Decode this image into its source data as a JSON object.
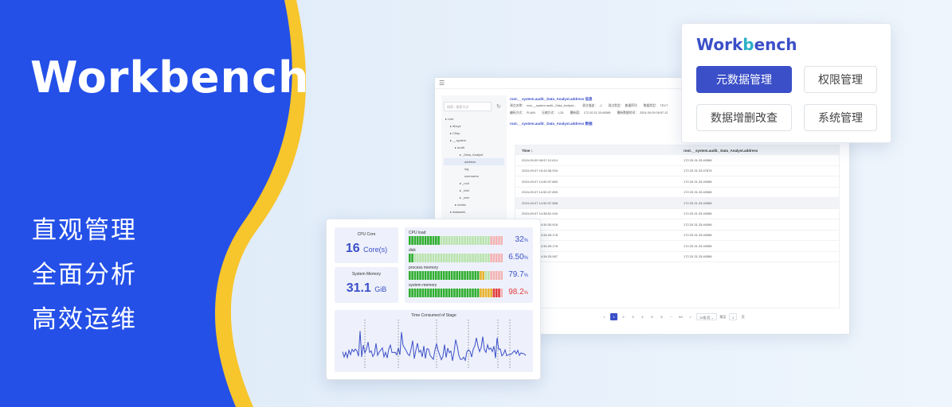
{
  "hero": {
    "title": "Workbench",
    "slogans": [
      "直观管理",
      "全面分析",
      "高效运维"
    ],
    "colors": {
      "blue": "#2450e8",
      "yellow": "#f7c52c"
    }
  },
  "popup": {
    "logo_main": "Work",
    "logo_accent": "b",
    "logo_rest": "ench",
    "buttons": [
      {
        "label": "元数据管理",
        "active": true
      },
      {
        "label": "权限管理",
        "active": false
      },
      {
        "label": "数据增删改查",
        "active": false
      },
      {
        "label": "系统管理",
        "active": false
      }
    ]
  },
  "app": {
    "menu_icon": "menu-icon",
    "search_placeholder": "搜索 / 搜索节点",
    "tree": [
      {
        "label": "root",
        "indent": 0
      },
      {
        "label": "abcyz",
        "indent": 1
      },
      {
        "label": "Clkrp",
        "indent": 1
      },
      {
        "label": "__system",
        "indent": 1
      },
      {
        "label": "audit",
        "indent": 2
      },
      {
        "label": "_Data_Analyst",
        "indent": 3
      },
      {
        "label": "address",
        "indent": 4,
        "selected": true
      },
      {
        "label": "log",
        "indent": 4
      },
      {
        "label": "username",
        "indent": 4
      },
      {
        "label": "_null",
        "indent": 3
      },
      {
        "label": "_test",
        "indent": 3
      },
      {
        "label": "_test",
        "indent": 3
      },
      {
        "label": "metric",
        "indent": 2
      },
      {
        "label": "dataseek",
        "indent": 1
      },
      {
        "label": "rec",
        "indent": 1
      }
    ],
    "info_title": "root.__system.audit._Data_Analyst.address 信息",
    "info_row1": [
      "测点名称：",
      "root.__system.audit._Data_Analyst...",
      "测点描述：",
      "-1",
      "测点类型：",
      "普通序列",
      "数据类型：",
      "TEXT"
    ],
    "info_row2": [
      "编码方式：",
      "PLAIN",
      "压缩方式：",
      "LZ4",
      "最新值：",
      "172.20.31.33:49386",
      "最新数据时间：",
      "2024-09-09 08:57:12"
    ],
    "data_title": "root.__system.audit._Data_Analyst.address 数据",
    "table": {
      "headers": [
        "Time ↕",
        "root.__system.audit._Data_Analyst.address"
      ],
      "rows": [
        [
          "2024-09-09 08:57:12.614",
          "172.20.31.33:49386"
        ],
        [
          "2024-09-07 15:43:36.934",
          "172.20.31.33:47876"
        ],
        [
          "2024-09-07 14:50:37.860",
          "172.20.31.33:49386"
        ],
        [
          "2024-09-07 14:50:37.859",
          "172.20.31.33:49386"
        ],
        [
          "2024-09-07 14:50:37.858",
          "172.20.31.33:49386"
        ],
        [
          "2024-09-07 14:38:51.040",
          "172.20.31.33:49386"
        ],
        [
          "2024-09-07 14:30:30.918",
          "172.20.31.33:49386"
        ],
        [
          "2024-09-07 14:34:25.178",
          "172.20.31.33:49386"
        ],
        [
          "2024-09-07 14:34:25.178",
          "172.20.31.33:49386"
        ],
        [
          "2024-09-07 14:34:25.087",
          "172.20.31.33:49386"
        ]
      ]
    },
    "pager": {
      "prev": "<",
      "pages": [
        "1",
        "2",
        "3",
        "4",
        "5",
        "6",
        "···",
        "64"
      ],
      "next": ">",
      "size": "10条/页",
      "goto": "跳至",
      "page_input": "1",
      "page_unit": "页"
    }
  },
  "monitor": {
    "cpu_core_label": "CPU Core",
    "cpu_core_value": "16",
    "cpu_core_unit": "Core(s)",
    "memory_label": "System Memory",
    "memory_value": "31.1",
    "memory_unit": "GiB",
    "meters": [
      {
        "label": "CPU load",
        "value": "32",
        "unit": "%",
        "fraction": 0.32
      },
      {
        "label": "disk",
        "value": "6.50",
        "unit": "%",
        "fraction": 0.065
      },
      {
        "label": "process memory",
        "value": "79.7",
        "unit": "%",
        "fraction": 0.797
      },
      {
        "label": "system memory",
        "value": "98.2",
        "unit": "%",
        "fraction": 0.982
      }
    ],
    "chart_title": "Time Consumed of Stage"
  }
}
